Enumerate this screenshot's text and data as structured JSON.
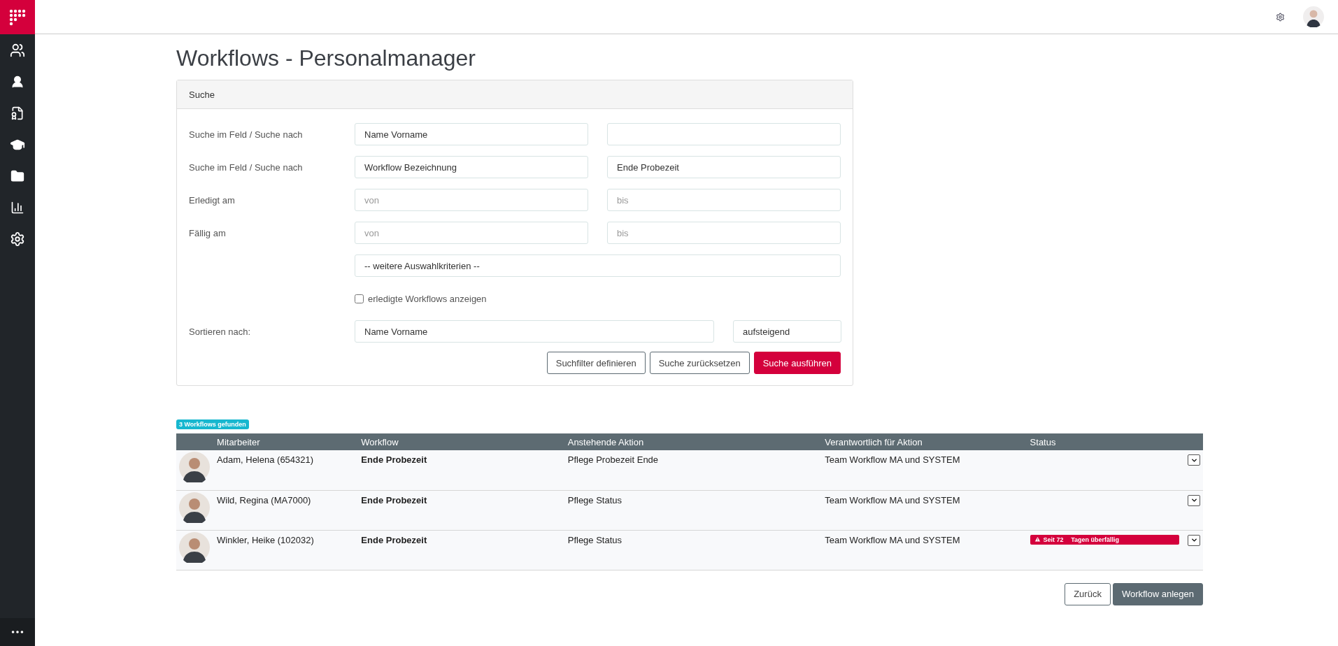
{
  "title": "Workflows - Personalmanager",
  "search": {
    "header": "Suche",
    "rows": [
      {
        "kind": "pair",
        "label": "Suche im Feld / Suche nach",
        "fields": [
          {
            "kind": "input",
            "value": "Name Vorname"
          },
          {
            "kind": "input"
          }
        ]
      },
      {
        "kind": "pair",
        "label": "Suche im Feld / Suche nach",
        "fields": [
          {
            "kind": "input",
            "value": "Workflow Bezeichnung"
          },
          {
            "kind": "input",
            "value": "Ende Probezeit"
          }
        ]
      },
      {
        "kind": "pair",
        "label": "Erledigt am",
        "fields": [
          {
            "kind": "input",
            "placeholder": "von"
          },
          {
            "kind": "input",
            "placeholder": "bis"
          }
        ]
      },
      {
        "kind": "pair",
        "label": "Fällig am",
        "fields": [
          {
            "kind": "input",
            "placeholder": "von"
          },
          {
            "kind": "input",
            "placeholder": "bis"
          }
        ]
      },
      {
        "kind": "wide",
        "fields": [
          {
            "kind": "input",
            "value": "-- weitere Auswahlkriterien --"
          }
        ]
      },
      {
        "kind": "checkbox",
        "text": "erledigte Workflows anzeigen",
        "checked": false
      },
      {
        "kind": "sort",
        "label": "Sortieren nach:",
        "fields": [
          {
            "kind": "input",
            "value": "Name Vorname"
          },
          {
            "kind": "input",
            "value": "aufsteigend"
          }
        ]
      }
    ],
    "buttons": [
      {
        "label": "Suchfilter definieren",
        "primary": false
      },
      {
        "label": "Suche zurücksetzen",
        "primary": false
      },
      {
        "label": "Suche ausführen",
        "primary": true
      }
    ]
  },
  "result_badge": "3 Workflows gefunden",
  "table": {
    "columns": [
      "Mitarbeiter",
      "Workflow",
      "Anstehende Aktion",
      "Verantwortlich für Aktion",
      "Status"
    ],
    "rows": [
      {
        "employee": "Adam, Helena (654321)",
        "workflow": "Ende Probezeit",
        "action": "Pflege Probezeit Ende",
        "responsible": "Team Workflow MA und SYSTEM"
      },
      {
        "employee": "Wild, Regina (MA7000)",
        "workflow": "Ende Probezeit",
        "action": "Pflege Status",
        "responsible": "Team Workflow MA und SYSTEM"
      },
      {
        "employee": "Winkler, Heike (102032)",
        "workflow": "Ende Probezeit",
        "action": "Pflege Status",
        "responsible": "Team Workflow MA und SYSTEM",
        "status": {
          "kind": "overdue",
          "days": "Seit 72",
          "text": "Tagen überfällig"
        }
      }
    ]
  },
  "footer_buttons": [
    {
      "label": "Zurück",
      "primary": false
    },
    {
      "label": "Workflow anlegen",
      "primary": true
    }
  ]
}
